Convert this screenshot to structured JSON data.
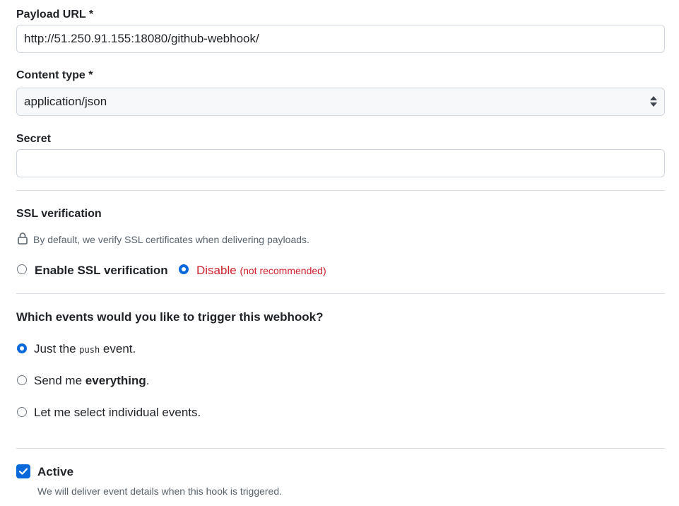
{
  "payload_url": {
    "label": "Payload URL *",
    "value": "http://51.250.91.155:18080/github-webhook/"
  },
  "content_type": {
    "label": "Content type *",
    "selected": "application/json"
  },
  "secret": {
    "label": "Secret",
    "value": ""
  },
  "ssl": {
    "title": "SSL verification",
    "description": "By default, we verify SSL certificates when delivering payloads.",
    "enable_label": "Enable SSL verification",
    "disable_label": "Disable",
    "disable_note": "(not recommended)",
    "selected": "disable"
  },
  "events": {
    "question": "Which events would you like to trigger this webhook?",
    "options": [
      {
        "prefix": "Just the",
        "code": "push",
        "suffix": "event.",
        "checked": true
      },
      {
        "prefix": "Send me",
        "bold": "everything",
        "suffix": ".",
        "checked": false
      },
      {
        "prefix": "Let me select individual events.",
        "checked": false
      }
    ]
  },
  "active": {
    "label": "Active",
    "checked": true,
    "description": "We will deliver event details when this hook is triggered."
  },
  "colors": {
    "accent": "#0969da",
    "danger": "#cf222e",
    "border": "#d0d7de"
  },
  "icons": {
    "ssl": "lock-icon",
    "active": "check-icon"
  }
}
